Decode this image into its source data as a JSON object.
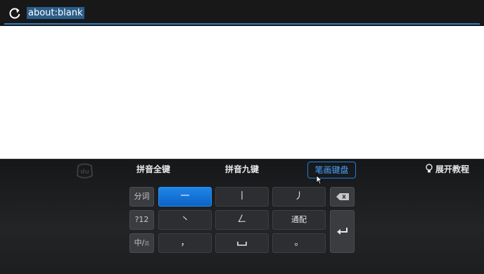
{
  "browser": {
    "url": "about:blank"
  },
  "keyboard": {
    "modes": [
      "拼音全键",
      "拼音九键",
      "笔画键盘"
    ],
    "active_mode": "笔画键盘",
    "tutorial_label": "展开教程",
    "side_keys": {
      "word": "分词",
      "numeric": "?12",
      "lang_main": "中/",
      "lang_sub": "英"
    },
    "strokes": [
      "一",
      "丨",
      "丿",
      "丶",
      "𠃋",
      "通配",
      "，",
      "␣",
      "。"
    ],
    "icons": {
      "reload": "reload-icon",
      "logo": "du-logo-icon",
      "tutorial": "lightbulb-icon",
      "backspace": "backspace-icon",
      "enter": "enter-icon",
      "space": "space-icon"
    }
  }
}
